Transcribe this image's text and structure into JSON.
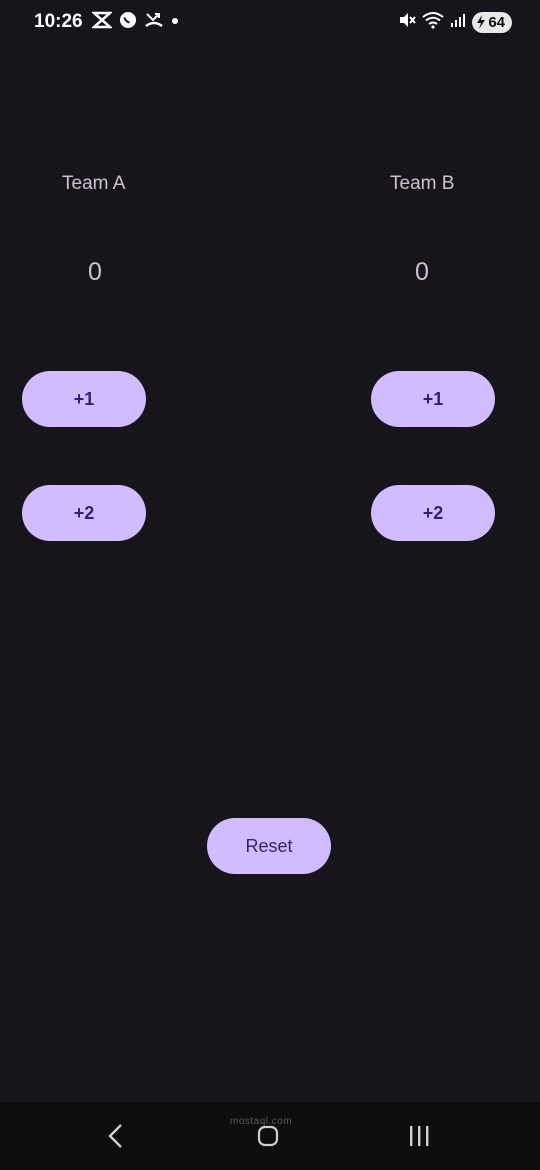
{
  "status_bar": {
    "time": "10:26",
    "battery_level": "64",
    "notification_icons": [
      "capcut-icon",
      "whatsapp-icon",
      "missed-call-icon",
      "dot-icon"
    ],
    "system_icons": [
      "mute-icon",
      "wifi-icon",
      "signal-icon",
      "battery-icon"
    ]
  },
  "team_a": {
    "name": "Team A",
    "score": "0",
    "plus_one": "+1",
    "plus_two": "+2"
  },
  "team_b": {
    "name": "Team B",
    "score": "0",
    "plus_one": "+1",
    "plus_two": "+2"
  },
  "reset_label": "Reset",
  "nav_bar": {
    "watermark": "mostaql.com"
  },
  "colors": {
    "background": "#17141c",
    "button": "#d0bcff",
    "button_text": "#381e72",
    "label": "#cac4d0"
  }
}
